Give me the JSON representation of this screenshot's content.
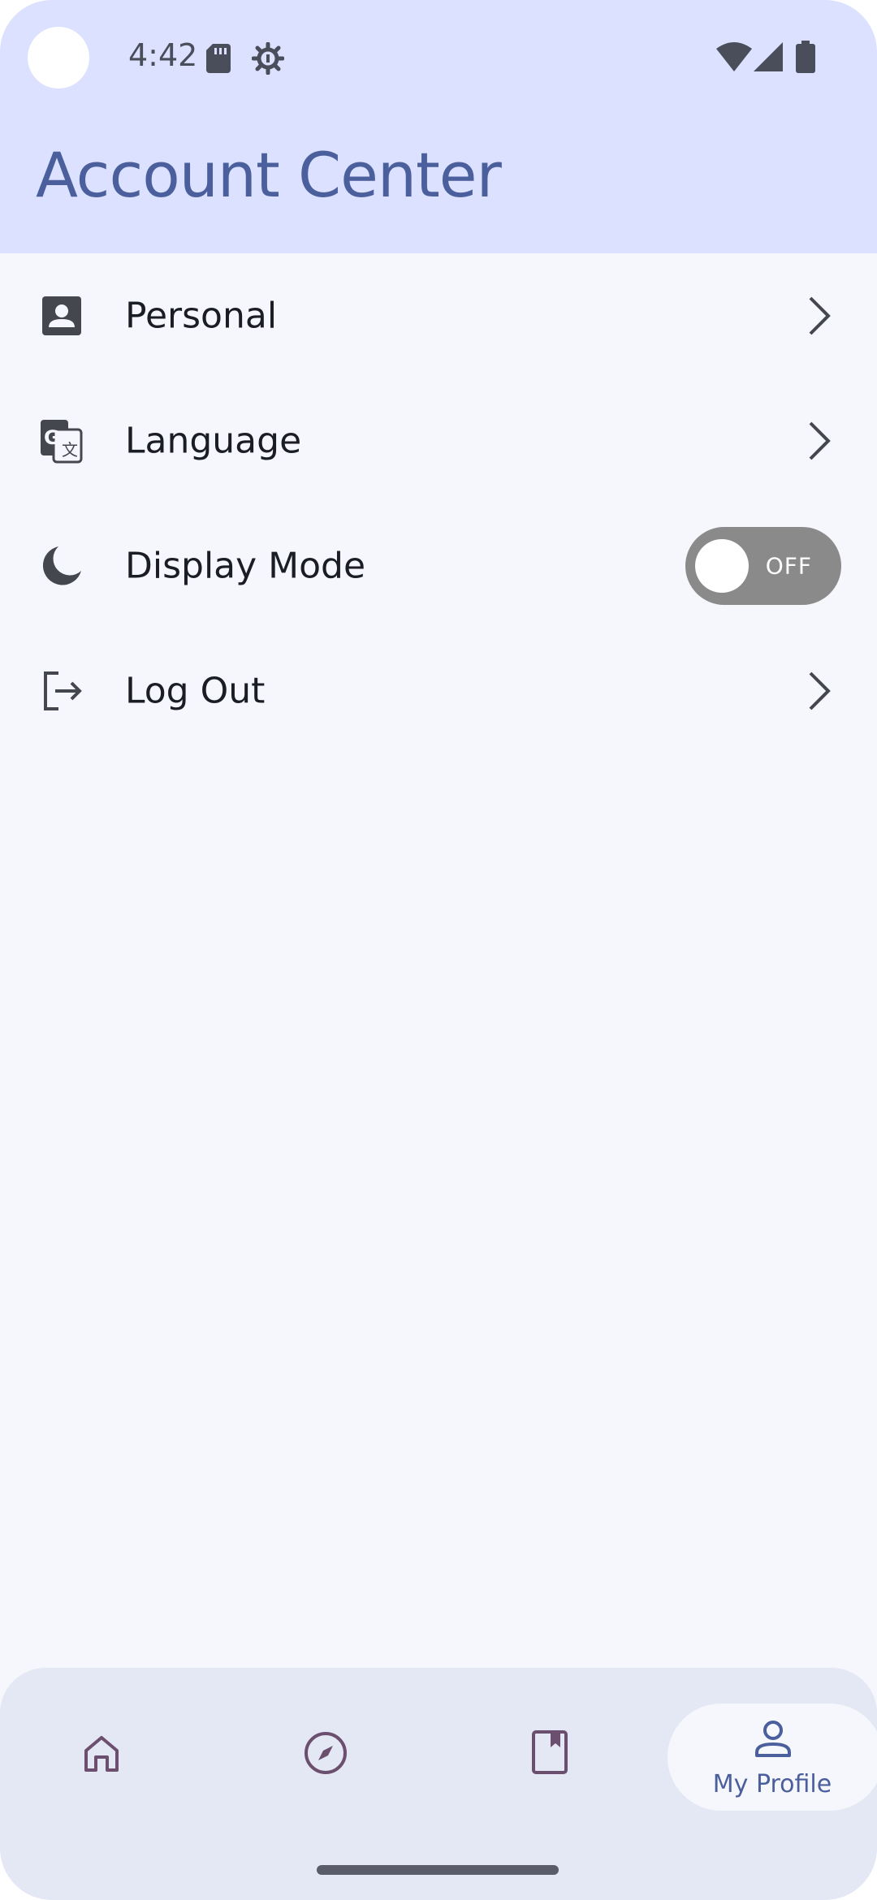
{
  "status_bar": {
    "time": "4:42",
    "left_icons": [
      "sd-card-icon",
      "settings-gear-icon"
    ],
    "right_icons": [
      "wifi-icon",
      "cell-signal-icon",
      "battery-icon"
    ]
  },
  "header": {
    "title": "Account Center",
    "background": "#dbe1ff",
    "title_color": "#4a5f9c"
  },
  "menu": {
    "items": [
      {
        "label": "Personal",
        "icon": "person-badge-icon",
        "trailing": "chevron-right-icon"
      },
      {
        "label": "Language",
        "icon": "translate-icon",
        "trailing": "chevron-right-icon"
      },
      {
        "label": "Display Mode",
        "icon": "moon-icon",
        "trailing": "toggle"
      },
      {
        "label": "Log Out",
        "icon": "logout-icon",
        "trailing": "chevron-right-icon"
      }
    ],
    "display_mode_toggle": {
      "state": "OFF",
      "on": false
    }
  },
  "bottom_nav": {
    "items": [
      {
        "icon": "home-icon",
        "label": ""
      },
      {
        "icon": "compass-icon",
        "label": ""
      },
      {
        "icon": "bookmark-book-icon",
        "label": ""
      },
      {
        "icon": "profile-icon",
        "label": "My Profile",
        "active": true
      }
    ],
    "active_color": "#4a5f9c",
    "inactive_color": "#6c4f6e"
  }
}
